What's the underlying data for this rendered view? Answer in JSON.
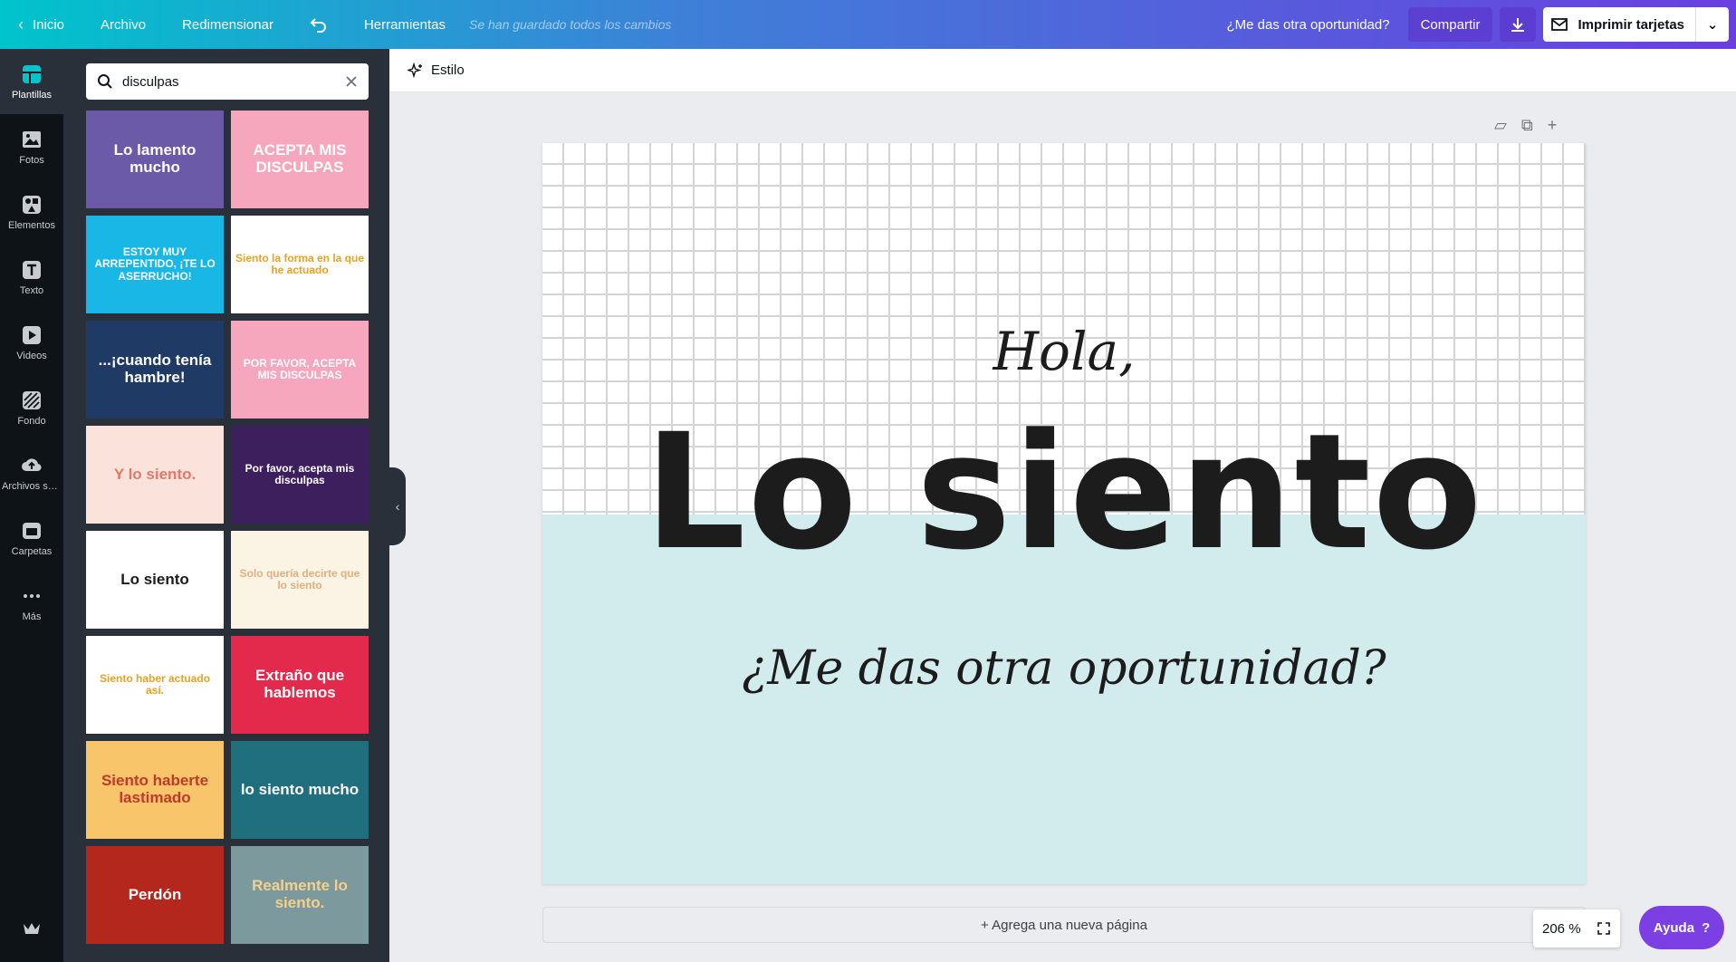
{
  "topbar": {
    "home": "Inicio",
    "file": "Archivo",
    "resize": "Redimensionar",
    "tools": "Herramientas",
    "saved_status": "Se han guardado todos los cambios",
    "doc_title": "¿Me das otra oportunidad?",
    "share": "Compartir",
    "print": "Imprimir tarjetas"
  },
  "rail": {
    "items": [
      {
        "label": "Plantillas",
        "icon": "templates-icon"
      },
      {
        "label": "Fotos",
        "icon": "photos-icon"
      },
      {
        "label": "Elementos",
        "icon": "elements-icon"
      },
      {
        "label": "Texto",
        "icon": "text-icon"
      },
      {
        "label": "Videos",
        "icon": "video-icon"
      },
      {
        "label": "Fondo",
        "icon": "background-icon"
      },
      {
        "label": "Archivos su...",
        "icon": "upload-icon"
      },
      {
        "label": "Carpetas",
        "icon": "folder-icon"
      },
      {
        "label": "Más",
        "icon": "more-icon"
      }
    ]
  },
  "panel": {
    "search_value": "disculpas",
    "templates": [
      {
        "text": "Lo lamento mucho",
        "bg": "#6a5aa8",
        "fg": "#ffffff"
      },
      {
        "text": "ACEPTA MIS DISCULPAS",
        "bg": "#f7a7bd",
        "fg": "#ffffff"
      },
      {
        "text": "ESTOY MUY ARREPENTIDO, ¡TE LO ASERRUCHO!",
        "bg": "#19b7e6",
        "fg": "#ffffff"
      },
      {
        "text": "Siento la forma en la que he actuado",
        "bg": "#ffffff",
        "fg": "#e8a320"
      },
      {
        "text": "...¡cuando tenía hambre!",
        "bg": "#1f3a64",
        "fg": "#ffffff"
      },
      {
        "text": "POR FAVOR, ACEPTA MIS DISCULPAS",
        "bg": "#f7a7bd",
        "fg": "#ffffff"
      },
      {
        "text": "Y lo siento.",
        "bg": "#fbe3dc",
        "fg": "#e07a6a"
      },
      {
        "text": "Por favor, acepta mis disculpas",
        "bg": "#3d1f5e",
        "fg": "#ffffff"
      },
      {
        "text": "Lo siento",
        "bg": "#ffffff",
        "fg": "#1c1c1c"
      },
      {
        "text": "Solo quería decirte que lo siento",
        "bg": "#fbf3e3",
        "fg": "#e0b080"
      },
      {
        "text": "Siento haber actuado así.",
        "bg": "#ffffff",
        "fg": "#e8a320"
      },
      {
        "text": "Extraño que hablemos",
        "bg": "#e32a4d",
        "fg": "#ffffff"
      },
      {
        "text": "Siento haberte lastimado",
        "bg": "#f9c56a",
        "fg": "#c0392b"
      },
      {
        "text": "lo siento mucho",
        "bg": "#1f6f7f",
        "fg": "#ffffff"
      },
      {
        "text": "Perdón",
        "bg": "#b3271c",
        "fg": "#ffffff"
      },
      {
        "text": "Realmente lo siento.",
        "bg": "#7c9a9e",
        "fg": "#f4d08c"
      }
    ]
  },
  "toolbar": {
    "style": "Estilo"
  },
  "canvas": {
    "greeting": "Hola,",
    "headline": "Lo siento",
    "subtitle": "¿Me das otra oportunidad?",
    "grid_color": "#d3d5d8",
    "lower_bg": "#d2ecee"
  },
  "footer": {
    "add_page": "+ Agrega una nueva página",
    "zoom": "206 %",
    "help": "Ayuda"
  },
  "colors": {
    "accent": "#7b3fe4",
    "rail_bg": "#0e1318",
    "panel_bg": "#293039"
  }
}
